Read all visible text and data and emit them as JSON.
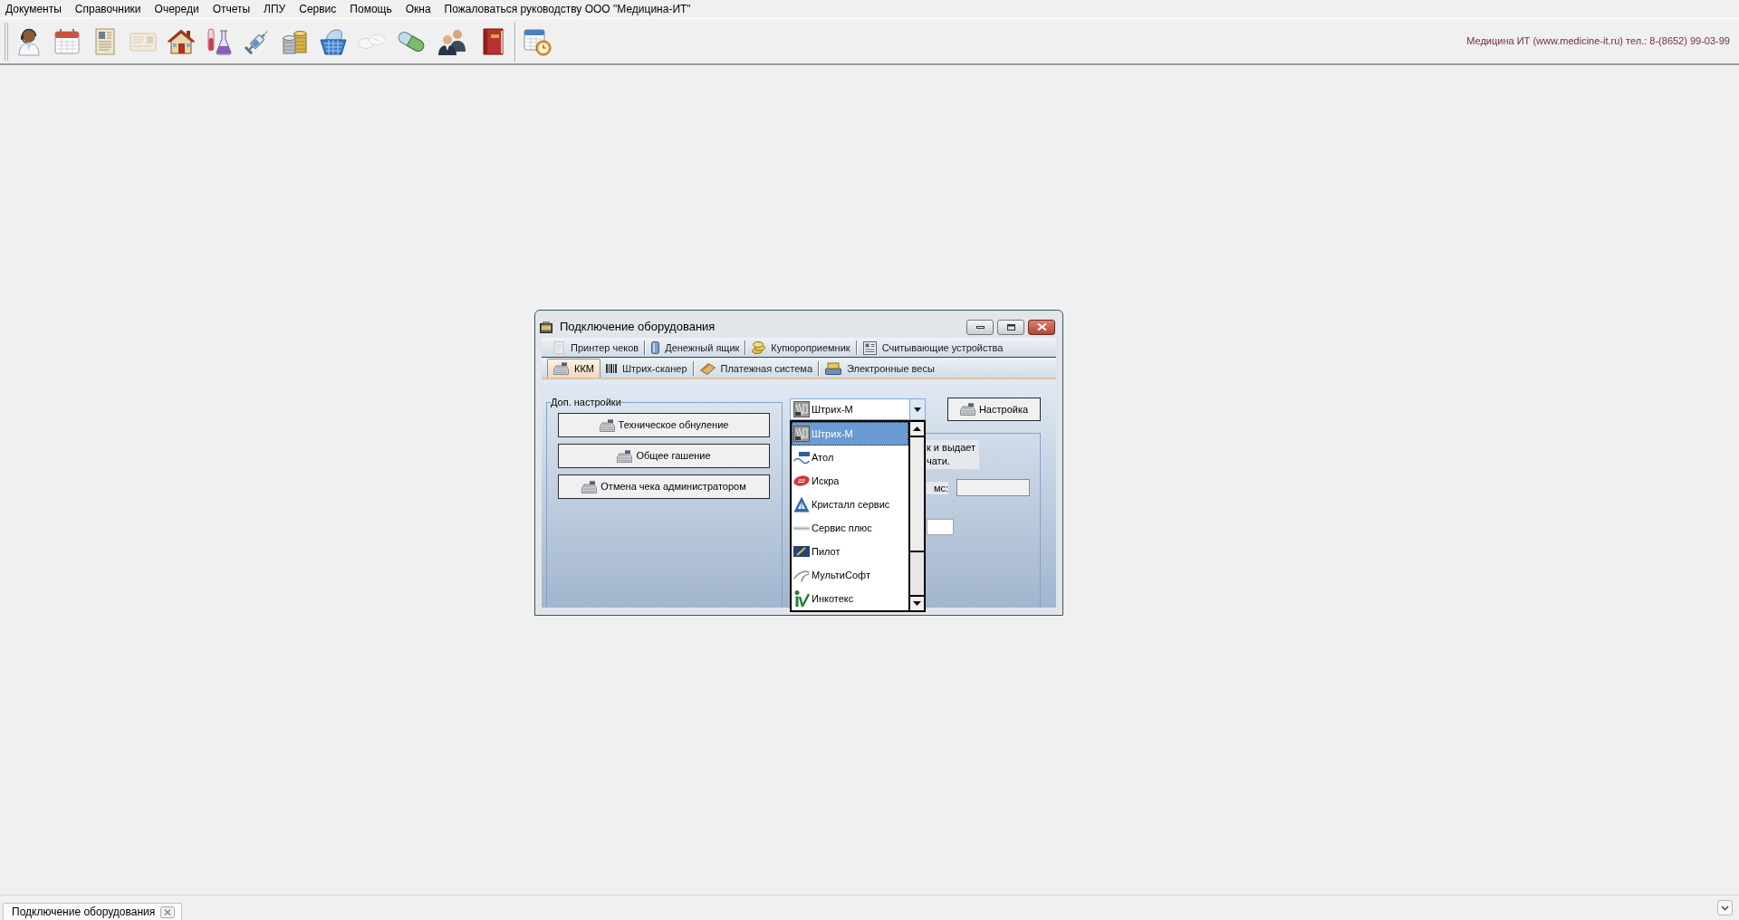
{
  "menu_bar": {
    "items": [
      "Документы",
      "Справочники",
      "Очереди",
      "Отчеты",
      "ЛПУ",
      "Сервис",
      "Помощь",
      "Окна",
      "Пожаловаться руководству ООО \"Медицина-ИТ\""
    ]
  },
  "toolbar": {
    "contact": "Медицина ИТ (www.medicine-it.ru) тел.: 8-(8652) 99-03-99"
  },
  "dialog": {
    "title": "Подключение оборудования",
    "tab_rows": [
      {
        "tabs": [
          {
            "label": "Принтер чеков",
            "selected": false
          },
          {
            "label": "Денежный ящик",
            "selected": false
          },
          {
            "label": "Купюроприемник",
            "selected": false
          },
          {
            "label": "Считывающие устройства",
            "selected": false
          }
        ]
      },
      {
        "tabs": [
          {
            "label": "ККМ",
            "selected": true
          },
          {
            "label": "Штрих-сканер",
            "selected": false
          },
          {
            "label": "Платежная система",
            "selected": false
          },
          {
            "label": "Электронные весы",
            "selected": false
          }
        ]
      }
    ],
    "extra_settings": {
      "title": "Доп. настройки",
      "buttons": [
        "Техническое обнуление",
        "Общее гашение",
        "Отмена чека администратором"
      ]
    },
    "device_select": {
      "value": "Штрих-М",
      "expanded": true,
      "options": [
        {
          "label": "Штрих-М",
          "selected": true
        },
        {
          "label": "Атол",
          "selected": false
        },
        {
          "label": "Искра",
          "selected": false
        },
        {
          "label": "Кристалл сервис",
          "selected": false
        },
        {
          "label": "Сервис плюс",
          "selected": false
        },
        {
          "label": "Пилот",
          "selected": false
        },
        {
          "label": "МультиСофт",
          "selected": false
        },
        {
          "label": "Инкотекс",
          "selected": false
        }
      ]
    },
    "settings_button": "Настройка",
    "covered_panel": {
      "description_lines": [
        "к и выдает",
        "чати."
      ],
      "field_label": "мс:"
    }
  },
  "window_tabs": [
    {
      "label": "Подключение оборудования",
      "selected": true
    }
  ]
}
